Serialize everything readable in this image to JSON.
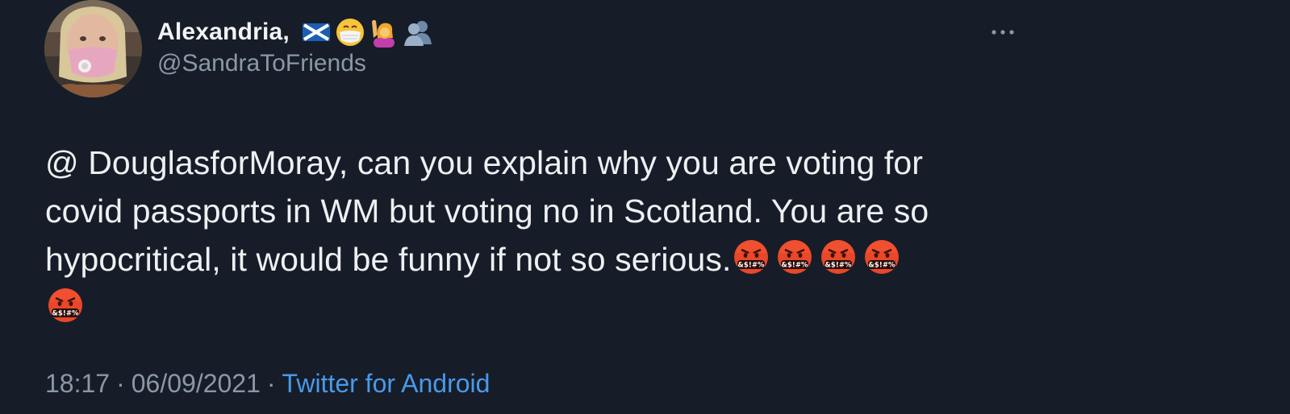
{
  "author": {
    "display_name": "Alexandria,",
    "name_emojis": [
      "scotland-flag-icon",
      "face-with-medical-mask-icon",
      "person-raising-hand-icon",
      "busts-in-silhouette-icon"
    ],
    "handle": "@SandraToFriends"
  },
  "tweet": {
    "text_line_1": "@ DouglasforMoray, can you explain why you are voting for",
    "text_line_2": "covid passports in WM but voting no in Scotland. You are so",
    "text_line_3": "hypocritical, it would be funny if not so serious.",
    "trailing_emojis": [
      "face-with-symbols-on-mouth-icon",
      "face-with-symbols-on-mouth-icon",
      "face-with-symbols-on-mouth-icon",
      "face-with-symbols-on-mouth-icon",
      "face-with-symbols-on-mouth-icon"
    ],
    "emoji_mouth_text": "&$!#%"
  },
  "meta": {
    "time": "18:17",
    "separator": "·",
    "date": "06/09/2021",
    "source": "Twitter for Android"
  },
  "colors": {
    "background": "#161d29",
    "text": "#eef0f1",
    "secondary": "#8b98a5",
    "link": "#4a99e9"
  }
}
